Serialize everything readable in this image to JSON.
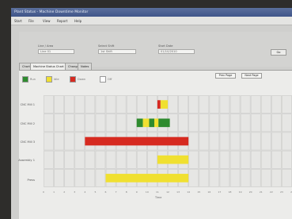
{
  "app": {
    "title": "Plant Status - Machine Downtime Monitor"
  },
  "menu": [
    "Start",
    "File",
    "View",
    "Report",
    "Help"
  ],
  "filters": {
    "field1": {
      "label": "Line / Area",
      "value": "Line 01"
    },
    "field2": {
      "label": "Select Shift",
      "value": "1st Shift"
    },
    "field3": {
      "label": "Start Date",
      "value": "01/10/2010"
    },
    "go_label": "Go"
  },
  "tabs": [
    "Chart",
    "Machine Status Chart",
    "Changes",
    "Notes"
  ],
  "legend": [
    {
      "label": "Run",
      "color": "#2e8b2e"
    },
    {
      "label": "Idle",
      "color": "#f0e030"
    },
    {
      "label": "Down",
      "color": "#d62a20"
    },
    {
      "label": "Off",
      "color": "#ffffff"
    }
  ],
  "page_buttons": [
    "Prev Page",
    "Next Page"
  ],
  "timeline": {
    "rows": [
      "CNC Mill 1",
      "CNC Mill 2",
      "CNC Mill 3",
      "Assembly 1",
      "Press"
    ],
    "hours": 24,
    "x_label": "Time",
    "segments": [
      {
        "row": 0,
        "start": 11,
        "end": 11.3,
        "color": "#d62a20"
      },
      {
        "row": 0,
        "start": 11.3,
        "end": 12,
        "color": "#f0e030"
      },
      {
        "row": 1,
        "start": 9,
        "end": 9.6,
        "color": "#2e8b2e"
      },
      {
        "row": 1,
        "start": 9.6,
        "end": 10.2,
        "color": "#f0e030"
      },
      {
        "row": 1,
        "start": 10.2,
        "end": 10.7,
        "color": "#2e8b2e"
      },
      {
        "row": 1,
        "start": 10.7,
        "end": 11.1,
        "color": "#f0e030"
      },
      {
        "row": 1,
        "start": 11.1,
        "end": 12.2,
        "color": "#2e8b2e"
      },
      {
        "row": 2,
        "start": 4,
        "end": 14,
        "color": "#d62a20"
      },
      {
        "row": 3,
        "start": 11,
        "end": 14,
        "color": "#f0e030"
      },
      {
        "row": 4,
        "start": 6,
        "end": 14,
        "color": "#f0e030"
      }
    ]
  }
}
